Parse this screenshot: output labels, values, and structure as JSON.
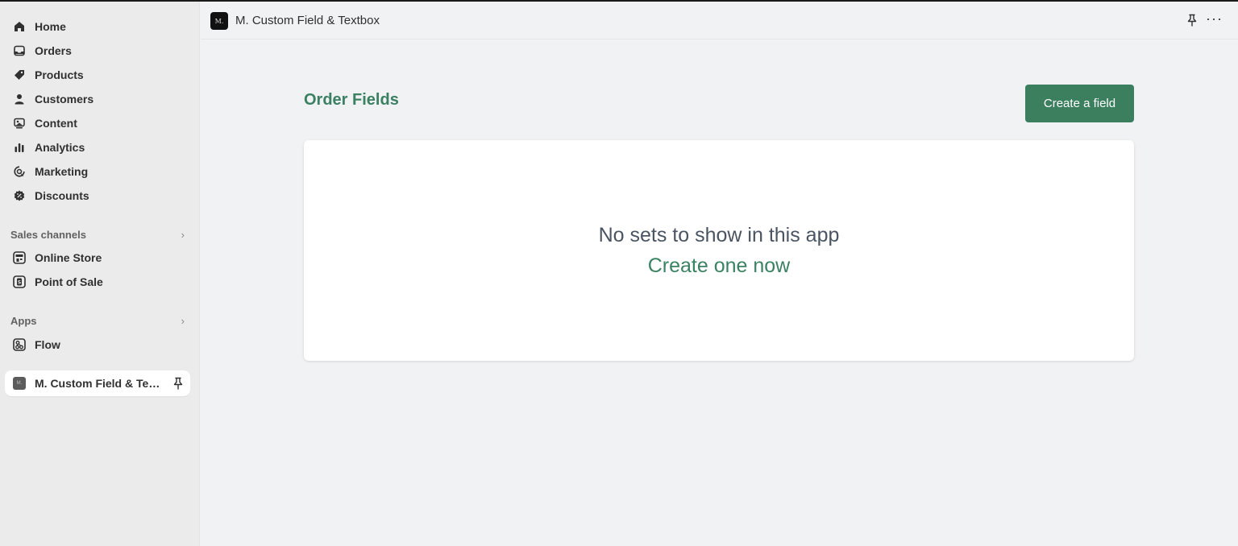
{
  "sidebar": {
    "items": [
      {
        "label": "Home",
        "icon": "home-icon"
      },
      {
        "label": "Orders",
        "icon": "inbox-icon"
      },
      {
        "label": "Products",
        "icon": "tag-icon"
      },
      {
        "label": "Customers",
        "icon": "person-icon"
      },
      {
        "label": "Content",
        "icon": "image-icon"
      },
      {
        "label": "Analytics",
        "icon": "bar-chart-icon"
      },
      {
        "label": "Marketing",
        "icon": "target-icon"
      },
      {
        "label": "Discounts",
        "icon": "discount-icon"
      }
    ],
    "sales_channels": {
      "heading": "Sales channels",
      "items": [
        {
          "label": "Online Store",
          "icon": "store-icon"
        },
        {
          "label": "Point of Sale",
          "icon": "pos-icon"
        }
      ]
    },
    "apps": {
      "heading": "Apps",
      "items": [
        {
          "label": "Flow",
          "icon": "flow-icon"
        }
      ]
    },
    "active_app": {
      "label": "M. Custom Field & Tex...",
      "icon": "app-logo-icon"
    }
  },
  "topbar": {
    "logo_text": "M.",
    "title": "M. Custom Field & Textbox",
    "more_label": "···"
  },
  "main": {
    "title": "Order Fields",
    "create_button": "Create a field",
    "empty_state": {
      "title": "No sets to show in this app",
      "link": "Create one now"
    }
  },
  "colors": {
    "accent": "#3c7f5f",
    "sidebar_bg": "#ebebeb",
    "page_bg": "#f1f2f4"
  }
}
